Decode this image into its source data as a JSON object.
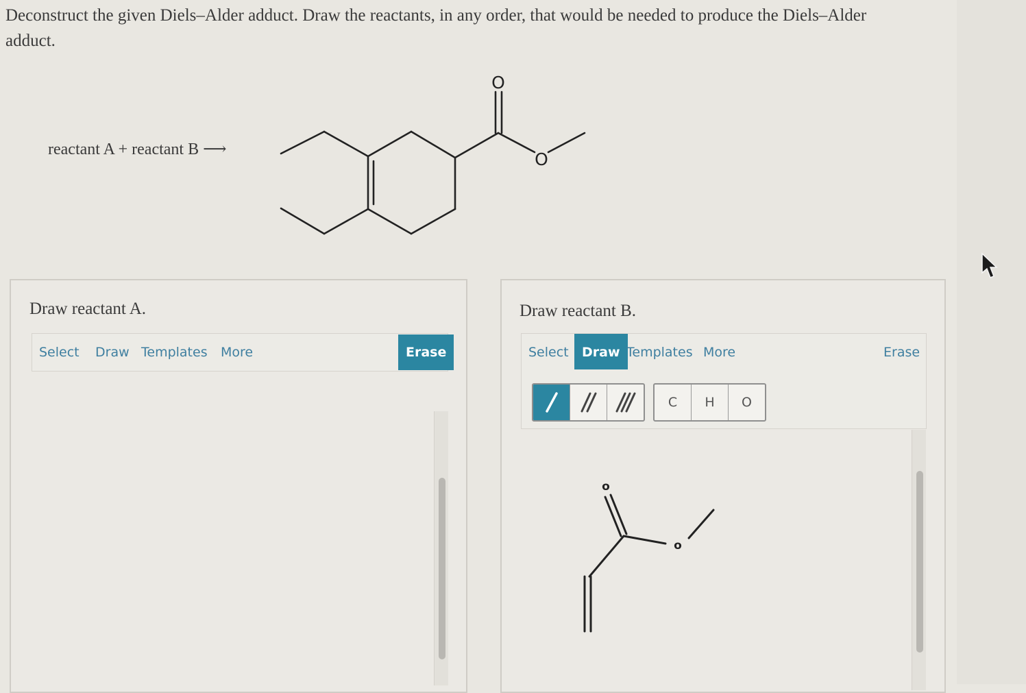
{
  "question": {
    "prompt": "Deconstruct the given Diels–Alder adduct. Draw the reactants, in any order, that would be needed to produce the Diels–Alder adduct.",
    "reaction_label": "reactant A + reactant B ⟶",
    "adduct_atom_labels": {
      "carbonyl_o": "O",
      "ester_o": "O"
    }
  },
  "panel_a": {
    "title": "Draw reactant A.",
    "toolbar": {
      "select": "Select",
      "draw": "Draw",
      "templates": "Templates",
      "more": "More",
      "erase": "Erase"
    }
  },
  "panel_b": {
    "title": "Draw reactant B.",
    "toolbar": {
      "select": "Select",
      "draw": "Draw",
      "templates": "Templates",
      "more": "More",
      "erase": "Erase",
      "active_tab": "Draw"
    },
    "bond_buttons": [
      "single-bond-icon",
      "double-bond-icon",
      "triple-bond-icon"
    ],
    "atom_buttons": [
      "C",
      "H",
      "O"
    ],
    "drawn_atom_labels": {
      "carbonyl_o": "o",
      "ester_o": "o"
    }
  },
  "colors": {
    "accent": "#2b86a1",
    "link": "#3f7fa0",
    "background": "#e9e7e1"
  }
}
